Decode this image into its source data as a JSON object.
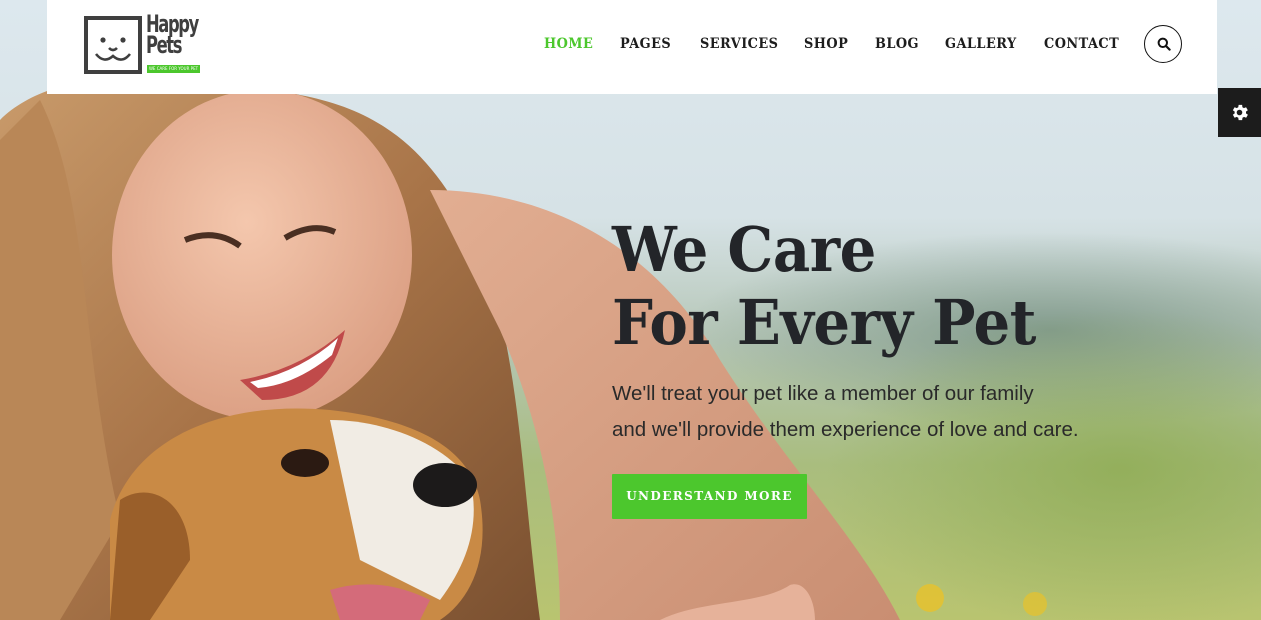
{
  "brand": {
    "logo_line1": "Happy",
    "logo_line2": "Pets",
    "logo_tagline": "WE CARE FOR YOUR PET",
    "accent_color": "#4cc72d"
  },
  "nav": {
    "items": [
      {
        "label": "HOME",
        "active": true
      },
      {
        "label": "PAGES",
        "active": false
      },
      {
        "label": "SERVICES",
        "active": false
      },
      {
        "label": "SHOP",
        "active": false
      },
      {
        "label": "BLOG",
        "active": false
      },
      {
        "label": "GALLERY",
        "active": false
      },
      {
        "label": "CONTACT",
        "active": false
      }
    ],
    "search_icon": "search-icon"
  },
  "settings": {
    "icon": "gear-icon"
  },
  "hero": {
    "title_line1": "We Care",
    "title_line2": "For Every Pet",
    "subtitle_line1": "We'll treat your pet like a member of our family",
    "subtitle_line2": "and we'll provide them experience of love and care.",
    "cta_label": "UNDERSTAND MORE",
    "image": "woman-hugging-dog-photo"
  }
}
